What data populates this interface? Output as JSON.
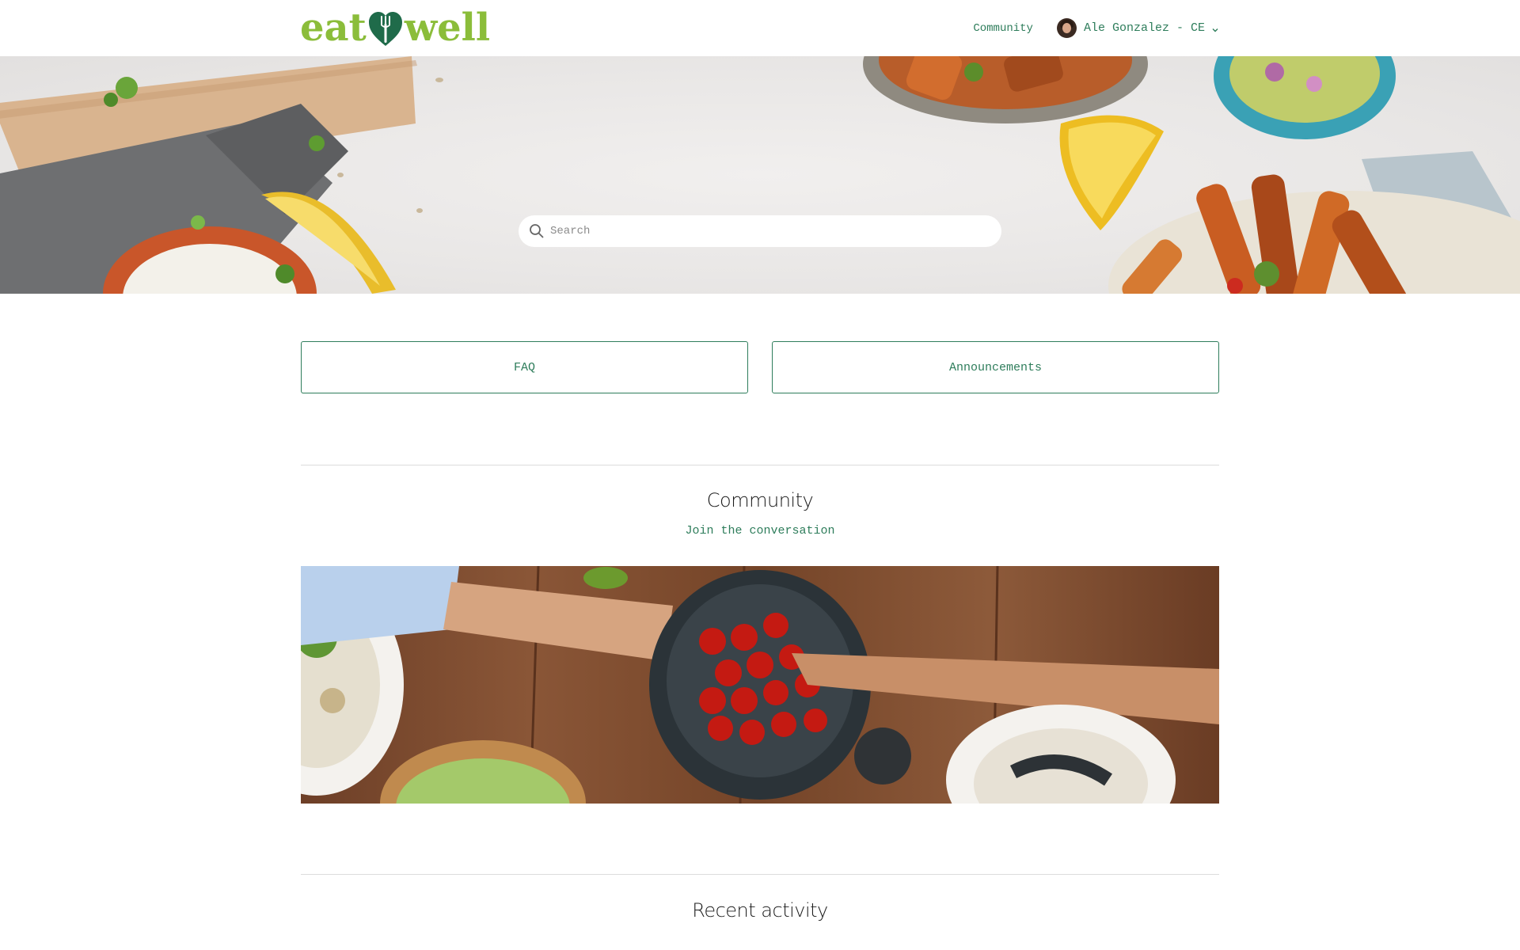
{
  "brand": {
    "logo_left": "eat",
    "logo_right": "well",
    "logo_color": "#8bbd3a",
    "accent_color": "#2e7d5b"
  },
  "header": {
    "nav_community": "Community",
    "user_name": "Ale Gonzalez - CE",
    "user_menu_icon": "chevron-down-icon"
  },
  "hero": {
    "search_placeholder": "Search",
    "search_icon": "search-icon"
  },
  "blocks": [
    {
      "label": "FAQ"
    },
    {
      "label": "Announcements"
    }
  ],
  "community": {
    "title": "Community",
    "subtitle": "Join the conversation"
  },
  "recent_activity": {
    "title": "Recent activity"
  }
}
